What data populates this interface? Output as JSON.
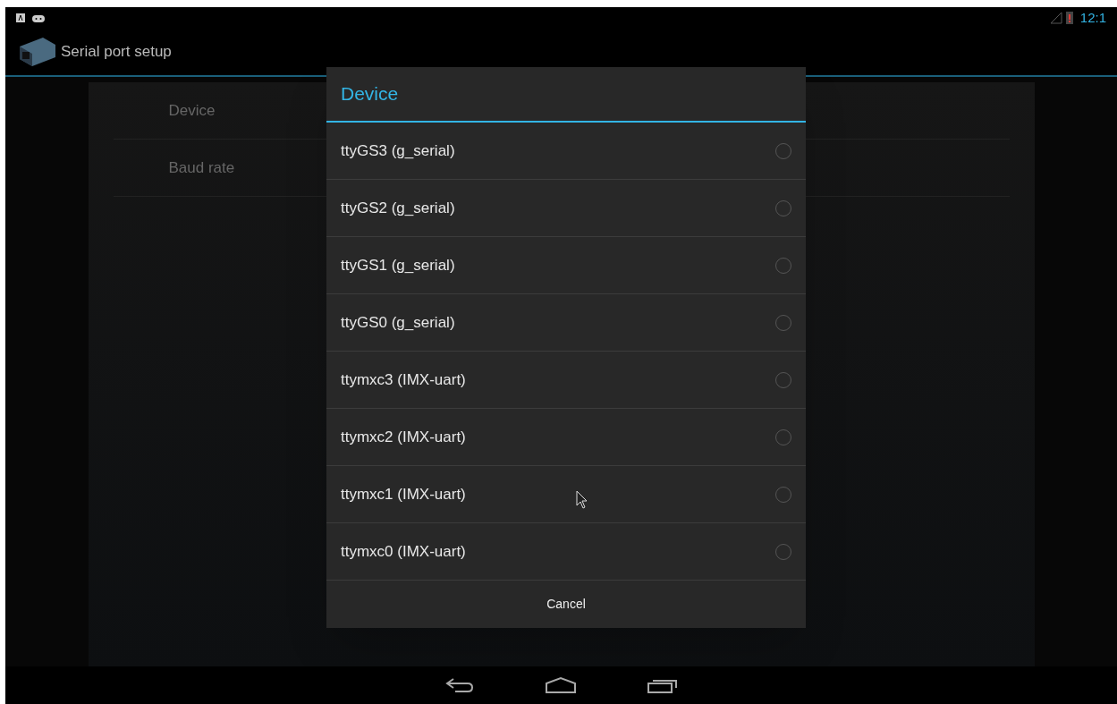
{
  "status_bar": {
    "time": "12:1"
  },
  "action_bar": {
    "title": "Serial port setup"
  },
  "settings": [
    {
      "label": "Device"
    },
    {
      "label": "Baud rate"
    }
  ],
  "dialog": {
    "title": "Device",
    "options": [
      {
        "label": "ttyGS3 (g_serial)",
        "selected": false
      },
      {
        "label": "ttyGS2 (g_serial)",
        "selected": false
      },
      {
        "label": "ttyGS1 (g_serial)",
        "selected": false
      },
      {
        "label": "ttyGS0 (g_serial)",
        "selected": false
      },
      {
        "label": "ttymxc3 (IMX-uart)",
        "selected": false
      },
      {
        "label": "ttymxc2 (IMX-uart)",
        "selected": false
      },
      {
        "label": "ttymxc1 (IMX-uart)",
        "selected": false
      },
      {
        "label": "ttymxc0 (IMX-uart)",
        "selected": false
      }
    ],
    "cancel": "Cancel"
  }
}
